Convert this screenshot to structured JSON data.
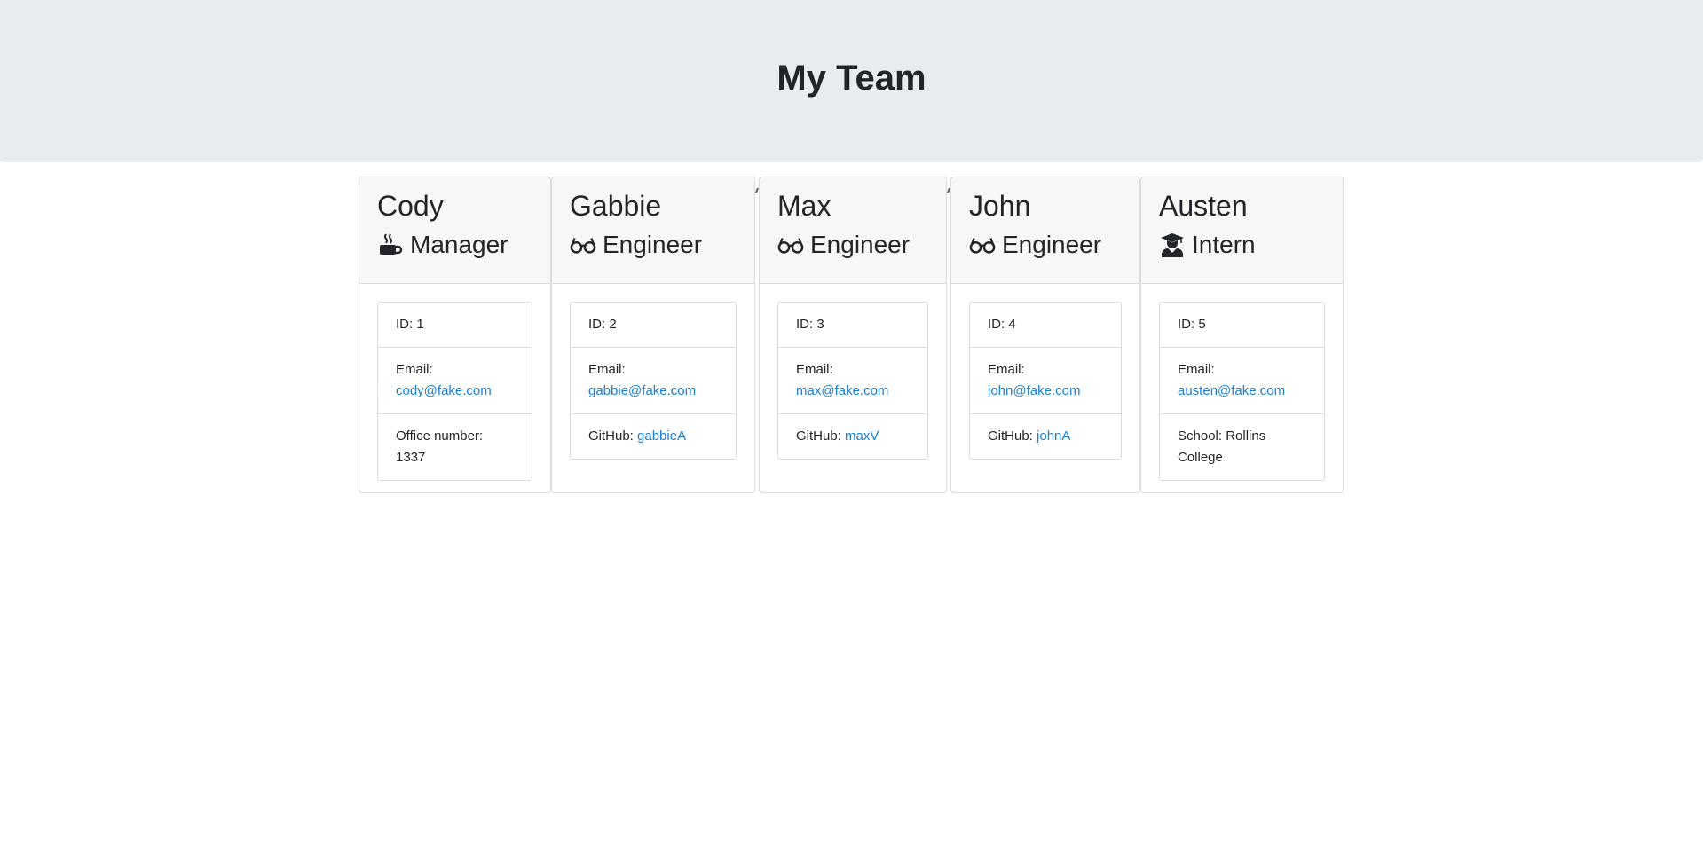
{
  "header": {
    "title": "My Team"
  },
  "team": [
    {
      "name": "Cody",
      "role": "Manager",
      "icon": "mug-icon",
      "id_text": "ID: 1",
      "email_label": "Email:",
      "email": "cody@fake.com",
      "extra_label": "Office number:",
      "extra_value": "1337"
    },
    {
      "name": "Gabbie",
      "role": "Engineer",
      "icon": "glasses-icon",
      "id_text": "ID: 2",
      "email_label": "Email:",
      "email": "gabbie@fake.com",
      "extra_label": "GitHub:",
      "extra_value": "gabbieA"
    },
    {
      "name": "Max",
      "role": "Engineer",
      "icon": "glasses-icon",
      "id_text": "ID: 3",
      "email_label": "Email:",
      "email": "max@fake.com",
      "extra_label": "GitHub:",
      "extra_value": "maxV"
    },
    {
      "name": "John",
      "role": "Engineer",
      "icon": "glasses-icon",
      "id_text": "ID: 4",
      "email_label": "Email:",
      "email": "john@fake.com",
      "extra_label": "GitHub:",
      "extra_value": "johnA"
    },
    {
      "name": "Austen",
      "role": "Intern",
      "icon": "graduate-icon",
      "id_text": "ID: 5",
      "email_label": "Email:",
      "email": "austen@fake.com",
      "extra_label": "School:",
      "extra_value": "Rollins College"
    }
  ],
  "colors": {
    "header_bg": "#e9ecef",
    "card_header_bg": "#f7f7f7",
    "link": "#1a7fd4",
    "text": "#212529"
  }
}
